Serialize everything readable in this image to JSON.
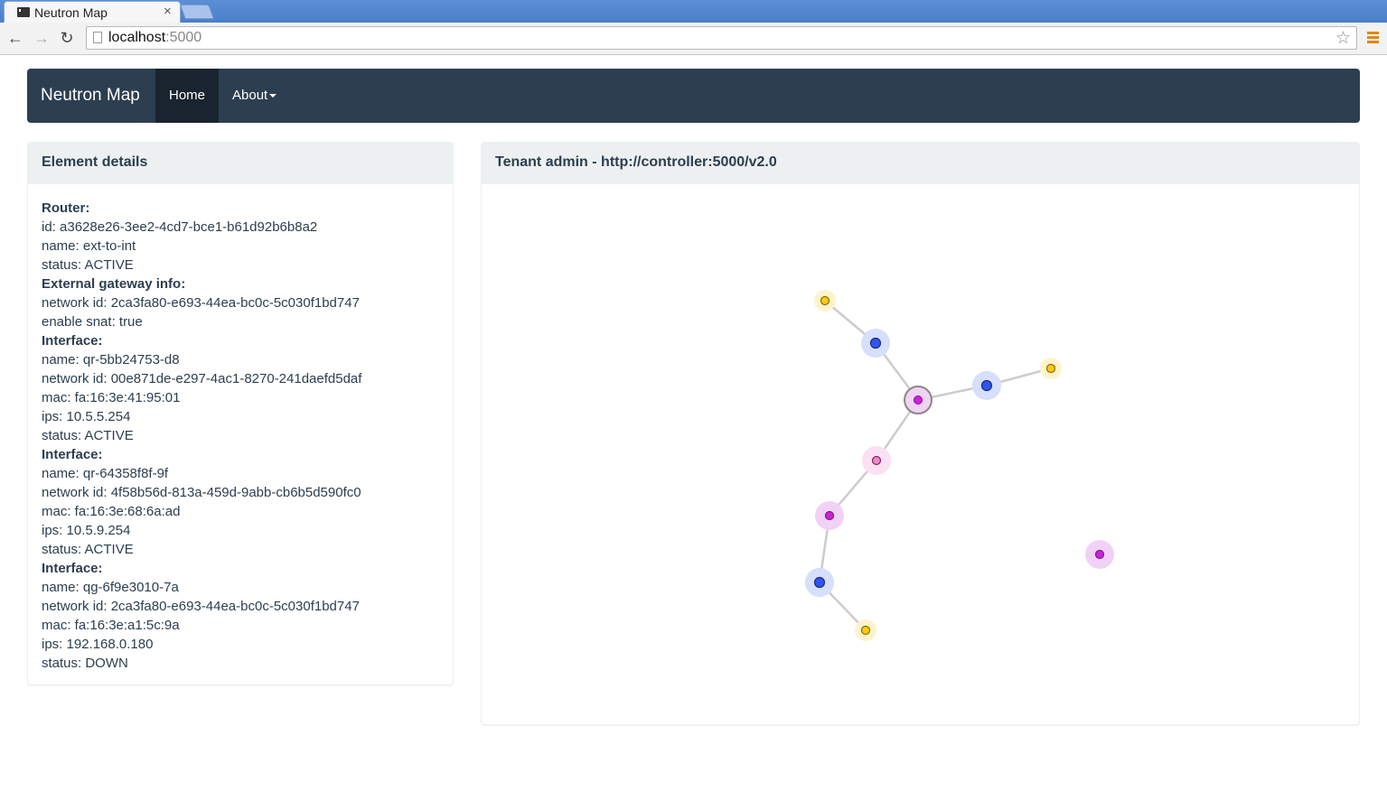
{
  "browser": {
    "tab_title": "Neutron Map",
    "tab_close": "×",
    "url_host": "localhost",
    "url_port": ":5000",
    "back_glyph": "←",
    "forward_glyph": "→",
    "reload_glyph": "↻",
    "star_glyph": "☆"
  },
  "navbar": {
    "brand": "Neutron Map",
    "items": [
      {
        "label": "Home",
        "active": true
      },
      {
        "label": "About",
        "dropdown": true
      }
    ]
  },
  "details_panel": {
    "title": "Element details",
    "lines": [
      {
        "text": "Router:",
        "header": true
      },
      {
        "text": "id: a3628e26-3ee2-4cd7-bce1-b61d92b6b8a2"
      },
      {
        "text": "name: ext-to-int"
      },
      {
        "text": "status: ACTIVE"
      },
      {
        "text": "External gateway info:",
        "header": true
      },
      {
        "text": "network id: 2ca3fa80-e693-44ea-bc0c-5c030f1bd747"
      },
      {
        "text": "enable snat: true"
      },
      {
        "text": "Interface:",
        "header": true
      },
      {
        "text": "name: qr-5bb24753-d8"
      },
      {
        "text": "network id: 00e871de-e297-4ac1-8270-241daefd5daf"
      },
      {
        "text": "mac: fa:16:3e:41:95:01"
      },
      {
        "text": "ips: 10.5.5.254"
      },
      {
        "text": "status: ACTIVE"
      },
      {
        "text": "Interface:",
        "header": true
      },
      {
        "text": "name: qr-64358f8f-9f"
      },
      {
        "text": "network id: 4f58b56d-813a-459d-9abb-cb6b5d590fc0"
      },
      {
        "text": "mac: fa:16:3e:68:6a:ad"
      },
      {
        "text": "ips: 10.5.9.254"
      },
      {
        "text": "status: ACTIVE"
      },
      {
        "text": "Interface:",
        "header": true
      },
      {
        "text": "name: qg-6f9e3010-7a"
      },
      {
        "text": "network id: 2ca3fa80-e693-44ea-bc0c-5c030f1bd747"
      },
      {
        "text": "mac: fa:16:3e:a1:5c:9a"
      },
      {
        "text": "ips: 192.168.0.180"
      },
      {
        "text": "status: DOWN"
      }
    ]
  },
  "map_panel": {
    "title": "Tenant admin  -  http://controller:5000/v2.0"
  },
  "colors": {
    "navbar_bg": "#2c3e50",
    "navbar_active_bg": "#1a242f",
    "panel_heading_bg": "#ecf0f1",
    "text": "#2c3e50",
    "node_blue": "#3355ee",
    "node_magenta": "#cc22dd",
    "node_pink": "#ee88cc",
    "node_yellow": "#ffcc11",
    "edge": "#cccccc"
  }
}
